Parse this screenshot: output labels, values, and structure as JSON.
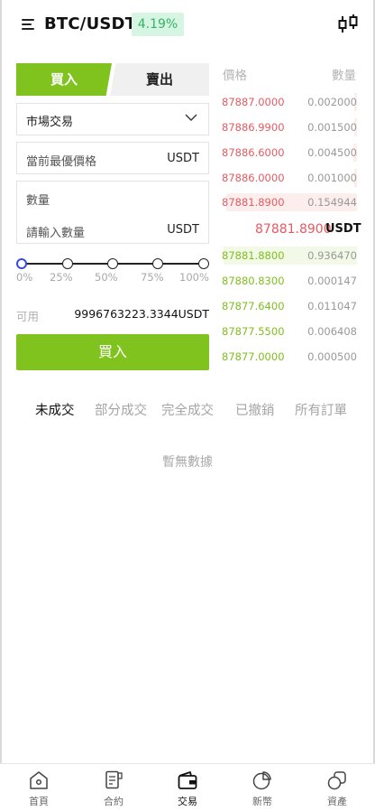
{
  "header": {
    "pair": "BTC/USDT",
    "change": "4.19%",
    "colors": {
      "up": "#37b267",
      "up_bg": "#d6f5e3",
      "accent": "#80c31e",
      "ask": "#e65a62"
    }
  },
  "trade_tabs": {
    "buy": "買入",
    "sell": "賣出"
  },
  "form": {
    "order_type": "市場交易",
    "price_placeholder": "當前最優價格",
    "price_unit": "USDT",
    "amount_label": "數量",
    "amount_placeholder": "請輸入數量",
    "amount_unit": "USDT",
    "slider_labels": [
      "0%",
      "25%",
      "50%",
      "75%",
      "100%"
    ],
    "slider_value": 0,
    "available_label": "可用",
    "available_value": "9996763223.3344USDT",
    "submit_label": "買入"
  },
  "orderbook": {
    "price_header": "價格",
    "qty_header": "數量",
    "asks": [
      {
        "price": "87887.0000",
        "qty": "0.002000",
        "depth": 0.02
      },
      {
        "price": "87886.9900",
        "qty": "0.001500",
        "depth": 0.02
      },
      {
        "price": "87886.6000",
        "qty": "0.004500",
        "depth": 0.03
      },
      {
        "price": "87886.0000",
        "qty": "0.001000",
        "depth": 0.02
      },
      {
        "price": "87881.8900",
        "qty": "0.154944",
        "depth": 0.97
      }
    ],
    "last_price": "87881.8900",
    "last_unit": "USDT",
    "bids": [
      {
        "price": "87881.8800",
        "qty": "0.936470",
        "depth": 0.99
      },
      {
        "price": "87880.8300",
        "qty": "0.000147",
        "depth": 0.0
      },
      {
        "price": "87877.6400",
        "qty": "0.011047",
        "depth": 0.0
      },
      {
        "price": "87877.5500",
        "qty": "0.006408",
        "depth": 0.0
      },
      {
        "price": "87877.0000",
        "qty": "0.000500",
        "depth": 0.0
      }
    ]
  },
  "order_tabs": [
    "未成交",
    "部分成交",
    "完全成交",
    "已撤銷",
    "所有訂單"
  ],
  "empty_text": "暫無數據",
  "nav": {
    "items": [
      {
        "label": "首頁",
        "icon": "home-icon"
      },
      {
        "label": "合約",
        "icon": "contract-icon"
      },
      {
        "label": "交易",
        "icon": "wallet-icon"
      },
      {
        "label": "新幣",
        "icon": "pie-chart-icon"
      },
      {
        "label": "資產",
        "icon": "assets-icon"
      }
    ],
    "active": 2
  }
}
